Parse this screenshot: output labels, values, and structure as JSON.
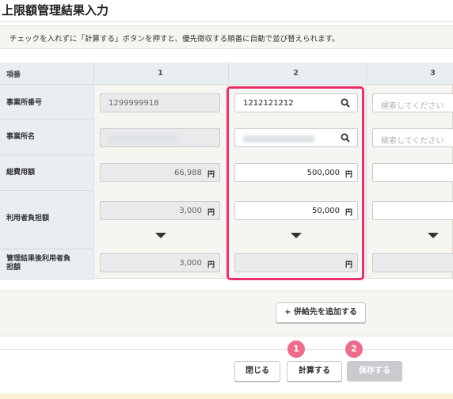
{
  "page": {
    "title": "上限額管理結果入力",
    "note": "チェックを入れずに「計算する」ボタンを押すと、優先徴収する順番に自動で並び替えられます。"
  },
  "table": {
    "header_label": "項番",
    "columns": [
      "1",
      "2",
      "3"
    ],
    "row_labels": {
      "office_number": "事業所番号",
      "office_name": "事業所名",
      "total_cost": "総費用額",
      "user_burden": "利用者負担額",
      "after_mgmt": [
        "管理結果後利用者負",
        "担額"
      ]
    },
    "col1": {
      "office_number": "1299999918",
      "total_cost": "66,988",
      "user_burden": "3,000",
      "after_mgmt": "3,000"
    },
    "col2": {
      "office_number": "1212121212",
      "total_cost": "500,000",
      "user_burden": "50,000",
      "after_mgmt": ""
    },
    "col3": {
      "search_placeholder": "検索してください"
    },
    "unit": "円"
  },
  "buttons": {
    "add_supplier": "+ 併給先を追加する",
    "close": "閉じる",
    "calculate": "計算する",
    "save": "保存する"
  },
  "badges": {
    "step1": "1",
    "step2": "2"
  },
  "colors": {
    "highlight": "#ec2f6f",
    "badge": "#ef6b8d"
  }
}
